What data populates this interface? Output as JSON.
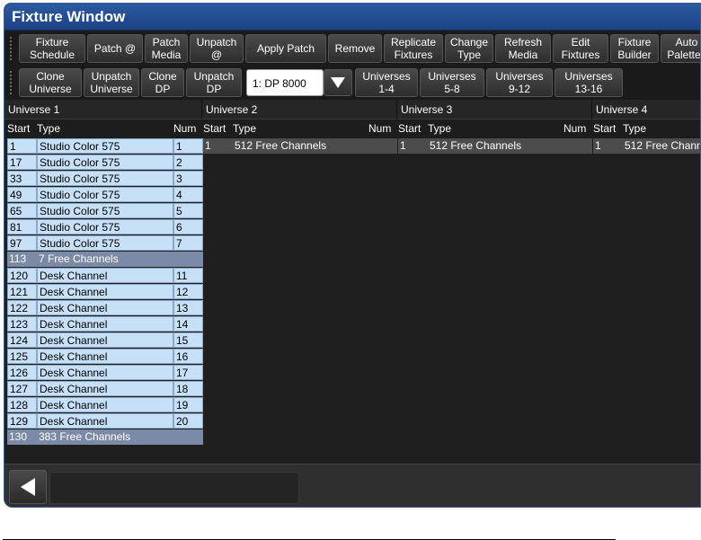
{
  "window": {
    "title": "Fixture Window"
  },
  "toolbar1": [
    {
      "label": "Fixture\nSchedule"
    },
    {
      "label": "Patch @"
    },
    {
      "label": "Patch\nMedia"
    },
    {
      "label": "Unpatch\n@"
    },
    {
      "label": "Apply Patch"
    },
    {
      "label": "Remove"
    },
    {
      "label": "Replicate\nFixtures"
    },
    {
      "label": "Change\nType"
    },
    {
      "label": "Refresh\nMedia"
    },
    {
      "label": "Edit\nFixtures"
    },
    {
      "label": "Fixture\nBuilder"
    },
    {
      "label": "Auto\nPalettes"
    }
  ],
  "toolbar2": {
    "left_buttons": [
      {
        "label": "Clone\nUniverse"
      },
      {
        "label": "Unpatch\nUniverse"
      },
      {
        "label": "Clone\nDP"
      },
      {
        "label": "Unpatch\nDP"
      }
    ],
    "dp_select": {
      "value": "1: DP 8000"
    },
    "universe_buttons": [
      {
        "label": "Universes\n1-4"
      },
      {
        "label": "Universes\n5-8"
      },
      {
        "label": "Universes\n9-12"
      },
      {
        "label": "Universes\n13-16"
      }
    ]
  },
  "grid": {
    "col_start": "Start",
    "col_type": "Type",
    "col_num": "Num",
    "universes": [
      {
        "title": "Universe 1"
      },
      {
        "title": "Universe 2"
      },
      {
        "title": "Universe 3"
      },
      {
        "title": "Universe 4"
      }
    ],
    "universe1_rows": [
      {
        "start": "1",
        "type": "Studio Color 575",
        "num": "1"
      },
      {
        "start": "17",
        "type": "Studio Color 575",
        "num": "2"
      },
      {
        "start": "33",
        "type": "Studio Color 575",
        "num": "3"
      },
      {
        "start": "49",
        "type": "Studio Color 575",
        "num": "4"
      },
      {
        "start": "65",
        "type": "Studio Color 575",
        "num": "5"
      },
      {
        "start": "81",
        "type": "Studio Color 575",
        "num": "6"
      },
      {
        "start": "97",
        "type": "Studio Color 575",
        "num": "7"
      },
      {
        "start": "113",
        "type": "7 Free Channels",
        "num": ""
      },
      {
        "start": "120",
        "type": "Desk Channel",
        "num": "11"
      },
      {
        "start": "121",
        "type": "Desk Channel",
        "num": "12"
      },
      {
        "start": "122",
        "type": "Desk Channel",
        "num": "13"
      },
      {
        "start": "123",
        "type": "Desk Channel",
        "num": "14"
      },
      {
        "start": "124",
        "type": "Desk Channel",
        "num": "15"
      },
      {
        "start": "125",
        "type": "Desk Channel",
        "num": "16"
      },
      {
        "start": "126",
        "type": "Desk Channel",
        "num": "17"
      },
      {
        "start": "127",
        "type": "Desk Channel",
        "num": "18"
      },
      {
        "start": "128",
        "type": "Desk Channel",
        "num": "19"
      },
      {
        "start": "129",
        "type": "Desk Channel",
        "num": "20"
      },
      {
        "start": "130",
        "type": "383 Free Channels",
        "num": ""
      }
    ],
    "other_universe_row": {
      "start": "1",
      "type": "512 Free Channels",
      "num": ""
    }
  },
  "icons": {
    "back": "left-arrow-icon",
    "dropdown": "down-triangle-icon"
  },
  "colors": {
    "title_bar": "#2c5aa0",
    "fixture_cell": "#c6e0f8",
    "free_cell": "#7b8aa6"
  }
}
